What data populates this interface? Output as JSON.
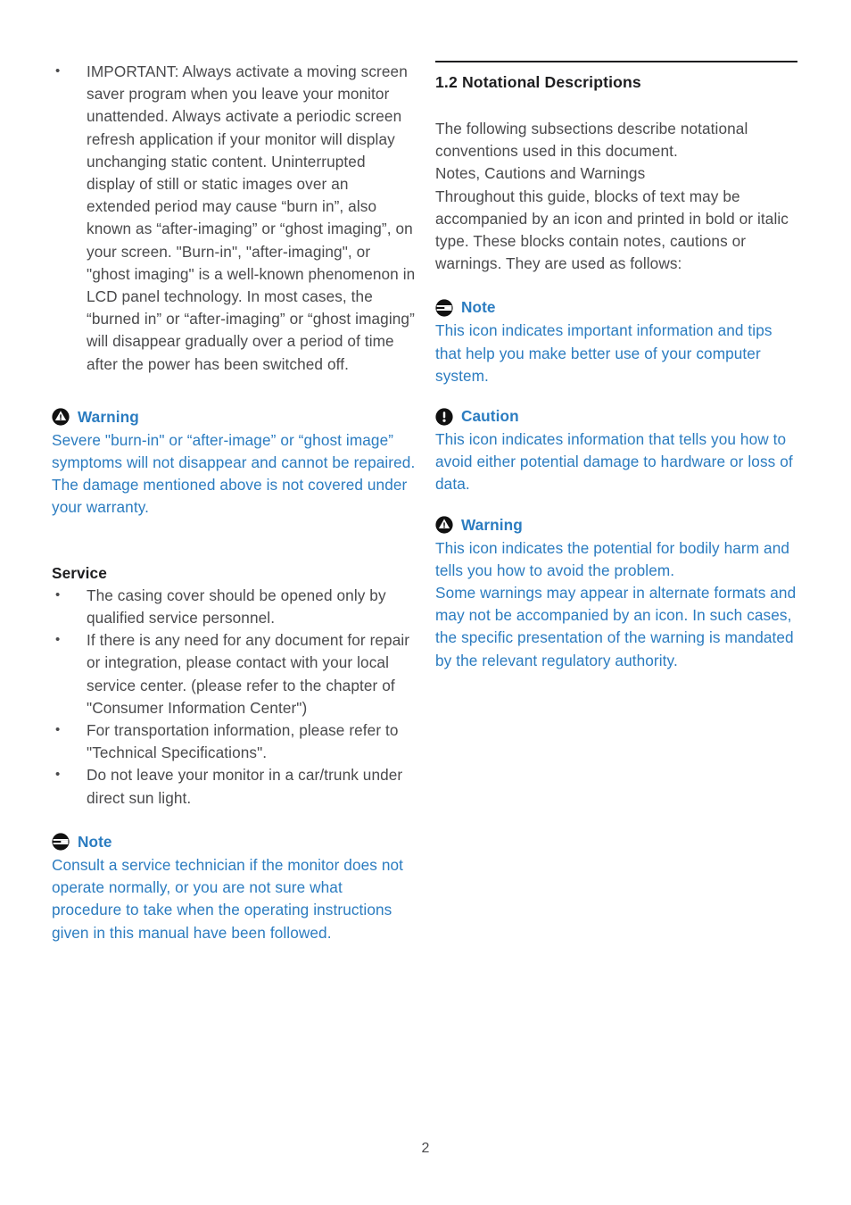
{
  "document": {
    "page_number": "2",
    "accent_blue": "#2b7cc0",
    "body_gray": "#4a4a4c",
    "heading_black": "#1d1d1f"
  },
  "left_column": {
    "important_bullet": "IMPORTANT: Always activate a moving screen saver program when you leave your monitor unattended. Always activate a periodic screen refresh application if your monitor will display unchanging static content. Uninterrupted display of still or static images over an extended period may cause “burn in”, also known as “after-imaging” or “ghost imaging”, on your screen. \"Burn-in\", \"after-imaging\", or \"ghost imaging\" is a well-known phenomenon in LCD panel technology. In most cases, the “burned in” or “after-imaging” or “ghost imaging” will disappear gradually over a period of time after the power has been switched off.",
    "warning_callout": {
      "icon": "warning-triangle-icon",
      "label": "Warning",
      "body": "Severe \"burn-in\" or “after-image” or “ghost image” symptoms will not disappear and cannot be repaired. The damage mentioned above is not covered under your warranty."
    },
    "service_heading": "Service",
    "service_bullets": [
      "The casing cover should be opened only by qualified service personnel.",
      "If there is any need for any document for repair or integration, please contact with your local service center. (please refer to the chapter of \"Consumer Information Center\")",
      "For transportation information, please refer to \"Technical Specifications\".",
      "Do not leave your monitor in a car/trunk under direct sun light."
    ],
    "note_callout": {
      "icon": "note-icon",
      "label": "Note",
      "body": "Consult a service technician if the monitor does not operate normally, or you are not sure what procedure to take when the operating instructions given in this manual have been followed."
    }
  },
  "right_column": {
    "section_title": "1.2 Notational Descriptions",
    "intro_paragraph_1": "The following subsections describe notational conventions used in this document.",
    "intro_subheading": "Notes, Cautions and Warnings",
    "intro_paragraph_2": "Throughout this guide, blocks of text may be accompanied by an icon and printed in bold or italic type. These blocks contain notes, cautions or warnings. They are used as follows:",
    "note_callout": {
      "icon": "note-icon",
      "label": "Note",
      "body": "This icon indicates important information and tips that help you make better use of your computer system."
    },
    "caution_callout": {
      "icon": "caution-exclamation-icon",
      "label": "Caution",
      "body": "This icon indicates information that tells you how to avoid either potential damage to hardware or loss of data."
    },
    "warning_callout": {
      "icon": "warning-triangle-icon",
      "label": "Warning",
      "body_1": "This icon indicates the potential for bodily harm and tells you how to avoid the problem.",
      "body_2": "Some warnings may appear in alternate formats and may not be accompanied by an icon. In such cases, the specific presentation of the warning is mandated by the relevant regulatory authority."
    }
  }
}
